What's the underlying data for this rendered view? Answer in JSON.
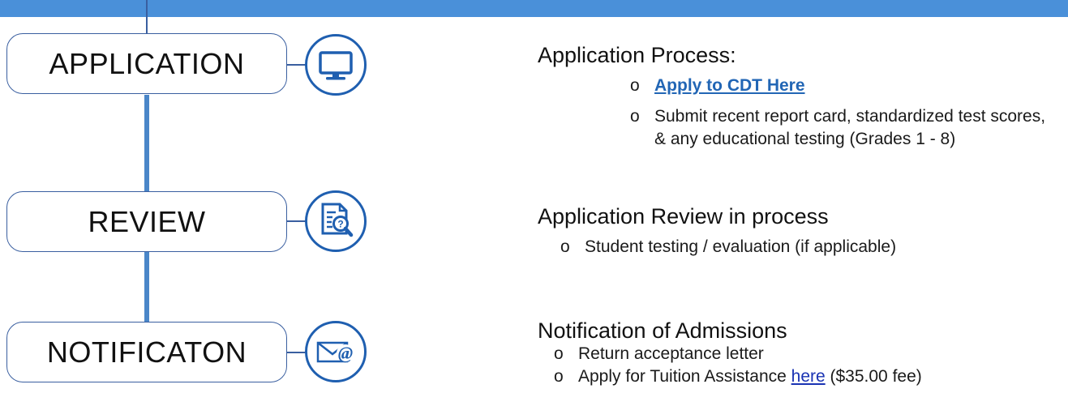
{
  "colors": {
    "top_bar": "#4a90d9",
    "connector": "#4a86c8",
    "icon_ring": "#1f5fb0",
    "link": "#2266b5"
  },
  "stages": [
    {
      "label": "APPLICATION",
      "icon": "monitor-icon"
    },
    {
      "label": "REVIEW",
      "icon": "document-search-icon"
    },
    {
      "label": "NOTIFICATON",
      "icon": "envelope-at-icon"
    }
  ],
  "sections": {
    "application": {
      "heading": "Application Process:",
      "bullet_mark": "o",
      "link_text": "Apply to CDT Here",
      "item2": "Submit recent report card, standardized test scores, & any educational testing (Grades 1 - 8)"
    },
    "review": {
      "heading": "Application Review in process",
      "bullet_mark": "o",
      "item1": "Student testing / evaluation (if applicable)"
    },
    "notification": {
      "heading": "Notification of Admissions",
      "bullet_mark": "o",
      "item1": "Return acceptance letter",
      "item2_prefix": "Apply for Tuition Assistance ",
      "item2_link": "here",
      "item2_suffix": " ($35.00 fee)"
    }
  }
}
